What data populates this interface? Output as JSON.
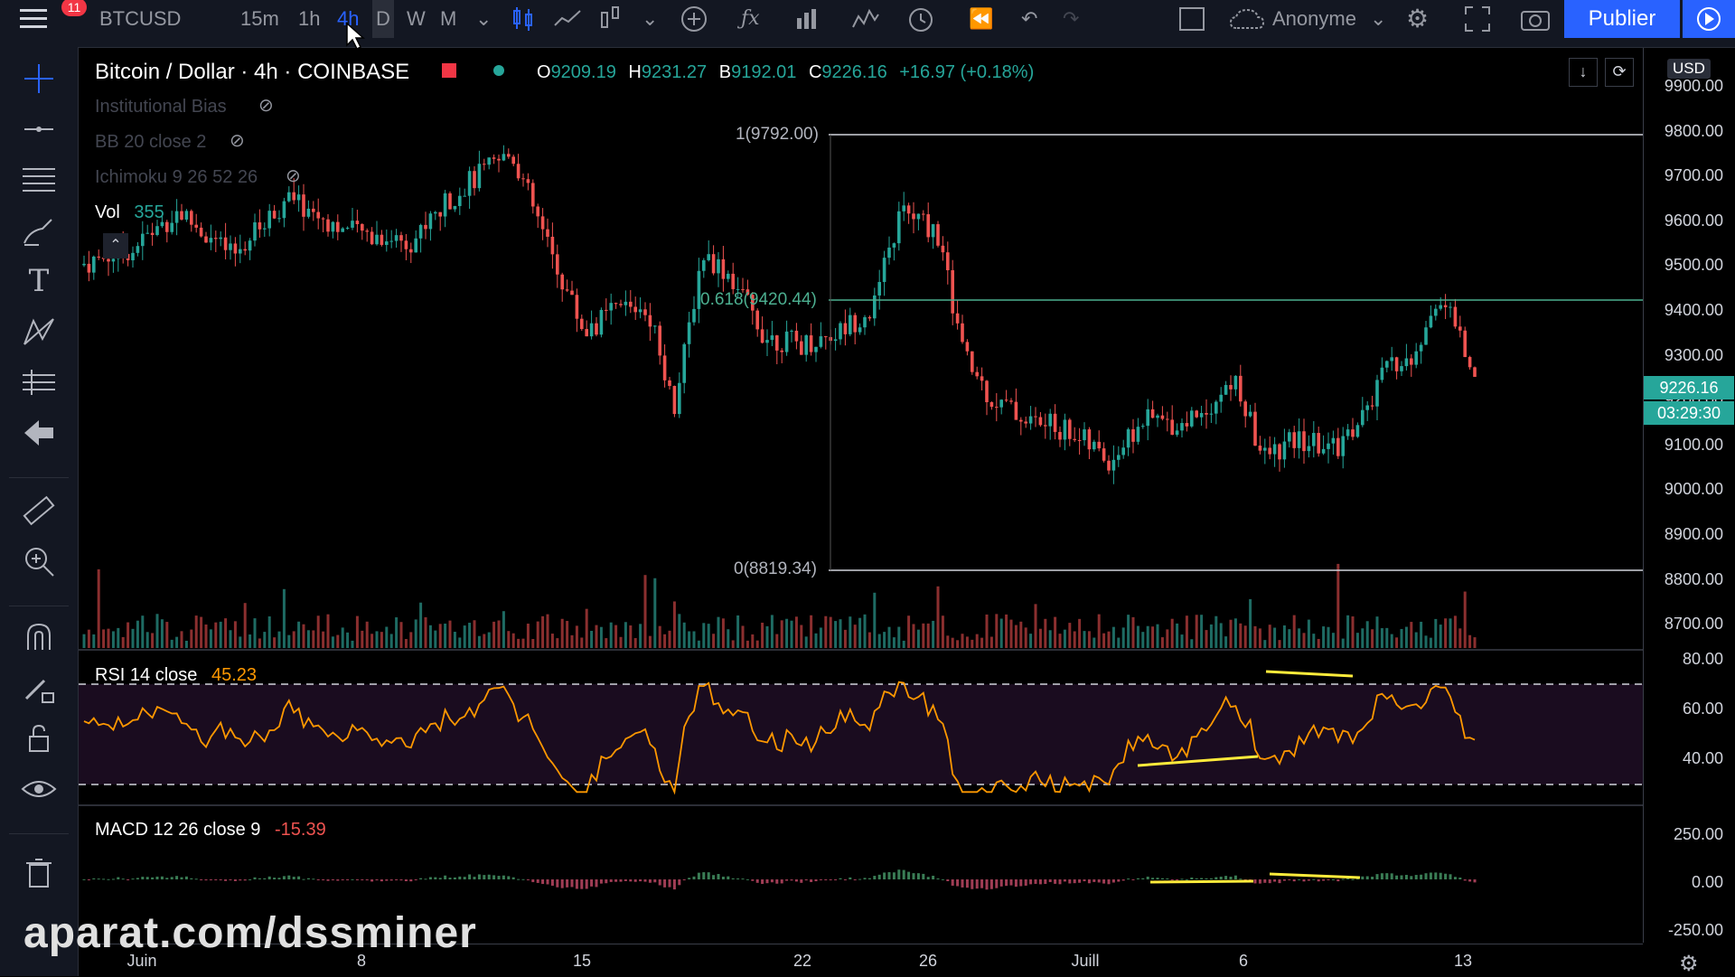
{
  "topbar": {
    "notifications": "11",
    "symbol": "BTCUSD",
    "intervals": [
      "15m",
      "1h",
      "4h",
      "D",
      "W",
      "M"
    ],
    "active_interval": "4h",
    "user": "Anonyme",
    "publish": "Publier",
    "icons": [
      "menu-icon",
      "candles-icon",
      "line-icon",
      "bar-type-icon",
      "add-icon",
      "fx-icon",
      "compare-icon",
      "indicators-icon",
      "alert-icon",
      "replay-icon",
      "undo-icon",
      "redo-icon",
      "layout-icon",
      "cloud-icon",
      "settings-icon",
      "fullscreen-icon",
      "camera-icon",
      "play-icon"
    ]
  },
  "sidebar": {
    "icons": [
      "crosshair-icon",
      "trend-line-icon",
      "horizontal-lines-icon",
      "brush-icon",
      "text-icon",
      "pattern-icon",
      "measure-icon",
      "back-arrow-icon",
      "ruler-icon",
      "zoom-icon",
      "magnet-icon",
      "lock-pencil-icon",
      "lock-icon",
      "eye-icon",
      "trash-icon"
    ]
  },
  "legend": {
    "title": "Bitcoin / Dollar · 4h · COINBASE",
    "open_label": "O",
    "open": "9209.19",
    "high_label": "H",
    "high": "9231.27",
    "low_label": "B",
    "low": "9192.01",
    "close_label": "C",
    "close": "9226.16",
    "change": "+16.97 (+0.18%)",
    "indicators": [
      "Institutional Bias",
      "BB 20 close 2",
      "Ichimoku 9 26 52 26"
    ],
    "vol_label": "Vol",
    "vol_value": "355"
  },
  "price_axis": {
    "currency": "USD",
    "labels": [
      "9900.00",
      "9800.00",
      "9700.00",
      "9600.00",
      "9500.00",
      "9400.00",
      "9300.00",
      "9200.00",
      "9100.00",
      "9000.00",
      "8900.00",
      "8800.00",
      "8700.00"
    ],
    "current_price": "9226.16",
    "countdown": "03:29:30"
  },
  "fib": {
    "level1": "1(9792.00)",
    "level618": "0.618(9420.44)",
    "level0": "0(8819.34)"
  },
  "rsi": {
    "label": "RSI 14 close",
    "value": "45.23",
    "axis": [
      "80.00",
      "60.00",
      "40.00"
    ]
  },
  "macd": {
    "label": "MACD 12 26 close 9",
    "value": "-15.39",
    "axis": [
      "250.00",
      "0.00",
      "-250.00"
    ]
  },
  "time_axis": {
    "ticks": [
      "Juin",
      "8",
      "15",
      "22",
      "26",
      "Juill",
      "6",
      "13"
    ]
  },
  "watermark": "aparat.com/dssminer",
  "colors": {
    "up": "#26a69a",
    "down": "#ef5350",
    "rsi": "#ff9800",
    "accent": "#2962ff",
    "trendline": "#ffeb3b"
  },
  "chart_data": {
    "type": "candlestick",
    "title": "Bitcoin / Dollar · 4h · COINBASE",
    "ylim": [
      8650,
      9950
    ],
    "x_ticks": [
      "Juin",
      "8",
      "15",
      "22",
      "26",
      "Juill",
      "6",
      "13"
    ],
    "fib_levels": [
      9792.0,
      9420.44,
      8819.34
    ],
    "last_close": 9226.16,
    "rsi_band": [
      30,
      70
    ],
    "rsi_last": 45.23,
    "macd_last": -15.39
  }
}
